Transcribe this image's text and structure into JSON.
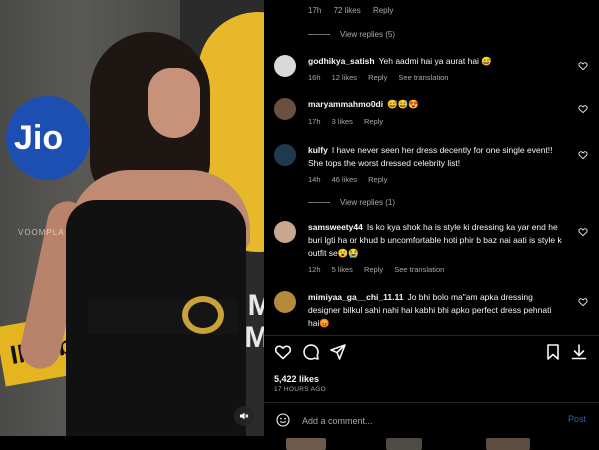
{
  "media": {
    "watermark": "VOOMPLA",
    "jio_logo": "Jio",
    "imdb_logo": "IMDb",
    "board_text": "UM\nLM",
    "mute_icon": "speaker-muted-icon"
  },
  "top_comment_meta": {
    "time": "17h",
    "likes": "72 likes",
    "reply": "Reply"
  },
  "view_replies_1": "View replies (5)",
  "view_replies_2": "View replies (1)",
  "comments": [
    {
      "username": "godhikya_satish",
      "text": "Yeh aadmi hai ya aurat hai 😅",
      "time": "16h",
      "likes": "12 likes",
      "reply": "Reply",
      "translation": "See translation",
      "avatar_color": "#d9d9d9"
    },
    {
      "username": "maryammahmo0di",
      "text": "😅😅😍",
      "time": "17h",
      "likes": "3 likes",
      "reply": "Reply",
      "translation": "",
      "avatar_color": "#6b4f3f"
    },
    {
      "username": "kulfy",
      "text": "I have never seen her dress decently for one single event!! She tops the worst dressed celebrity list!",
      "time": "14h",
      "likes": "46 likes",
      "reply": "Reply",
      "translation": "",
      "avatar_color": "#1e3a4f"
    },
    {
      "username": "samsweety44",
      "text": "Is ko kya shok ha is style ki dressing ka yar end he buri lgti ha or khud b uncomfortable hoti phir b baz nai aati is style k outfit se😮😭",
      "time": "12h",
      "likes": "5 likes",
      "reply": "Reply",
      "translation": "See translation",
      "avatar_color": "#c9a78f"
    },
    {
      "username": "mimiyaa_ga__chi_11.11",
      "text": "Jo bhi bolo ma\"am apka dressing designer bilkul sahi nahi hai kabhi bhi apko perfect dress pehnati hai😡",
      "time": "",
      "likes": "",
      "reply": "",
      "translation": "",
      "avatar_color": "#b58a3c"
    }
  ],
  "likes_count": "5,422 likes",
  "time_ago": "17 HOURS AGO",
  "add_comment": {
    "placeholder": "Add a comment...",
    "post_label": "Post"
  },
  "icons": {
    "like": "heart-icon",
    "comment": "comment-icon",
    "share": "share-icon",
    "save": "bookmark-icon",
    "download": "download-icon",
    "emoji": "emoji-icon"
  },
  "colors": {
    "background": "#000000",
    "text": "#f5f5f5",
    "muted": "#a8a8a8",
    "post_button": "#3b5aa6"
  }
}
